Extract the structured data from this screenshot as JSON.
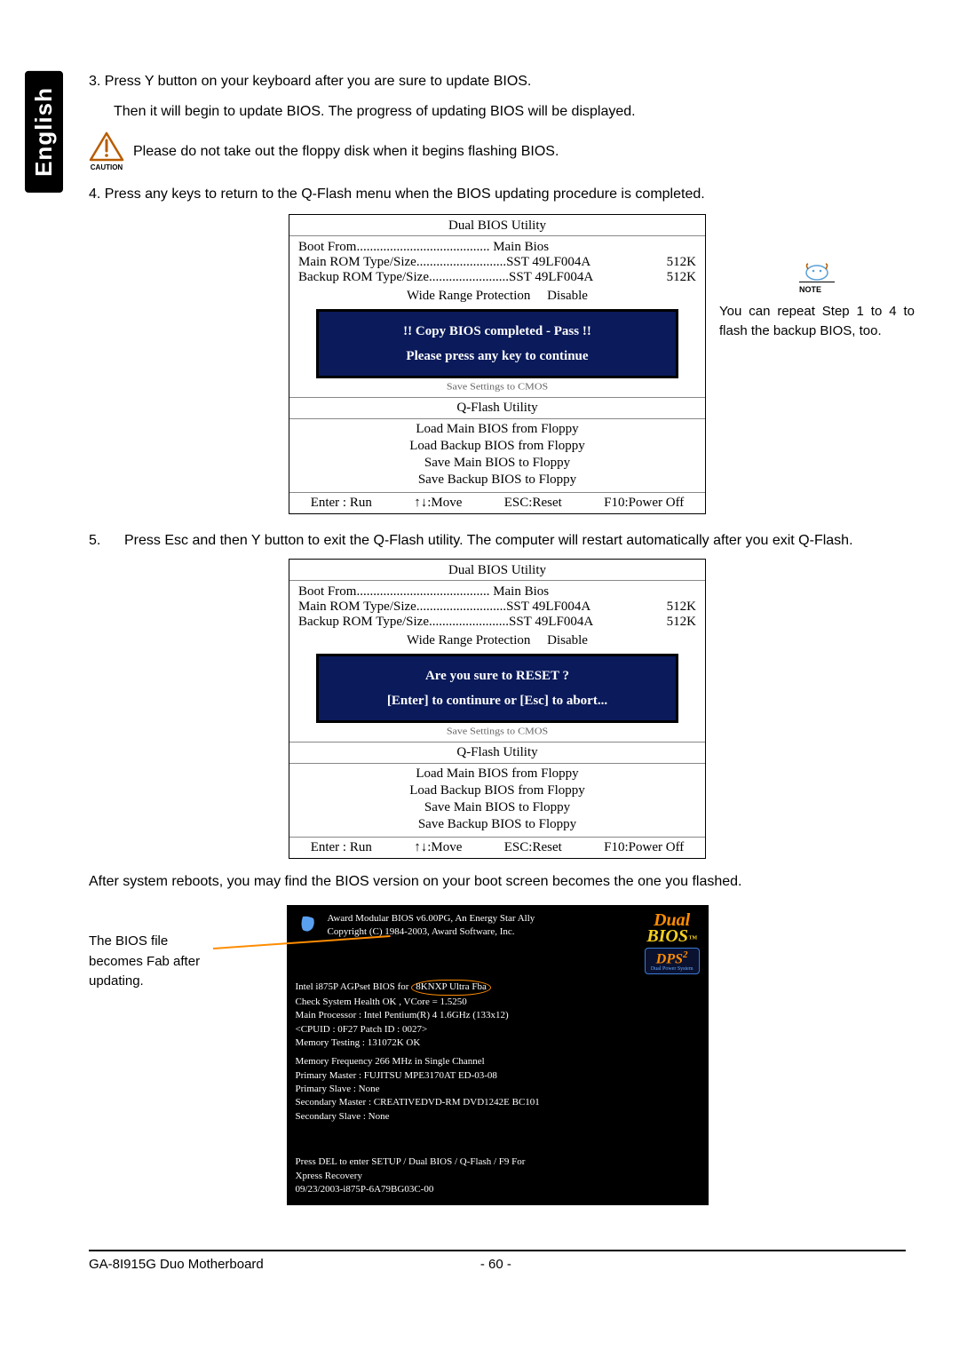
{
  "sideTab": "English",
  "step3_line1": "3. Press Y button on your keyboard after you are sure to update BIOS.",
  "step3_line2": "Then it will begin to update BIOS. The progress of updating BIOS will be displayed.",
  "caution_label": "CAUTION",
  "caution_text": "Please do not take out the floppy disk when it begins flashing BIOS.",
  "step4": "4. Press any keys to return to the Q-Flash menu when the BIOS updating procedure is completed.",
  "bios": {
    "title": "Dual BIOS Utility",
    "boot_label": "Boot From",
    "boot_dots": "........................................",
    "boot_val": "Main Bios",
    "main_label": "Main ROM Type/Size",
    "main_dots": "...........................",
    "main_val": "SST 49LF004A",
    "main_size": "512K",
    "backup_label": "Backup ROM Type/Size",
    "backup_dots": "........................",
    "backup_val": "SST 49LF004A",
    "backup_size": "512K",
    "wr_label": "Wide Range Protection",
    "wr_val": "Disable",
    "qflash_title": "Q-Flash Utility",
    "menu": [
      "Load Main BIOS from Floppy",
      "Load Backup BIOS from Floppy",
      "Save Main BIOS to Floppy",
      "Save Backup BIOS to Floppy"
    ],
    "ctrl_enter": "Enter : Run",
    "ctrl_move": "↑↓:Move",
    "ctrl_esc": "ESC:Reset",
    "ctrl_f10": "F10:Power Off",
    "inner1_a": "!! Copy BIOS completed - Pass !!",
    "inner1_b": "Please press any key to continue",
    "inner2_a": "Are you sure to RESET ?",
    "inner2_b": "[Enter] to continure or [Esc] to abort...",
    "under": "Save Settings to CMOS"
  },
  "note_label": "NOTE",
  "note_text": "You can repeat Step 1 to 4 to flash the backup BIOS, too.",
  "step5_num": "5.",
  "step5_text": "Press Esc and then Y button to exit the Q-Flash utility. The computer will restart automatically after you exit Q-Flash.",
  "after_text": "After system reboots, you may find the BIOS version on your boot screen becomes the one you flashed.",
  "bios_file_note_l1": "The BIOS file",
  "bios_file_note_l2": "becomes Fab after",
  "bios_file_note_l3": "updating.",
  "boot": {
    "hdr1": "Award Modular BIOS v6.00PG, An Energy Star Ally",
    "hdr2": "Copyright  (C) 1984-2003, Award Software,  Inc.",
    "a1a": "Intel i875P AGPset BIOS for",
    "a1b_callout": "8KNXP Ultra Fba",
    "a2": "Check System Health OK , VCore = 1.5250",
    "a3": "Main Processor :  Intel Pentium(R) 4  1.6GHz (133x12)",
    "a4": "<CPUID : 0F27 Patch ID :  0027>",
    "a5": "Memory Testing  : 131072K OK",
    "b1": "Memory Frequency 266 MHz in Single Channel",
    "b2": "Primary Master : FUJITSU MPE3170AT ED-03-08",
    "b3": "Primary Slave : None",
    "b4": "Secondary Master :  CREATIVEDVD-RM DVD1242E BC101",
    "b5": "Secondary Slave : None",
    "c1": "Press DEL to enter SETUP / Dual BIOS / Q-Flash / F9 For",
    "c2": "Xpress Recovery",
    "c3": "09/23/2003-i875P-6A79BG03C-00",
    "dual_a": "Dual",
    "dual_b": "BIOS",
    "dps": "DPS",
    "dps2": "2",
    "dps_sub": "Dual Power System"
  },
  "footer_left": "GA-8I915G Duo Motherboard",
  "footer_page": "- 60 -"
}
